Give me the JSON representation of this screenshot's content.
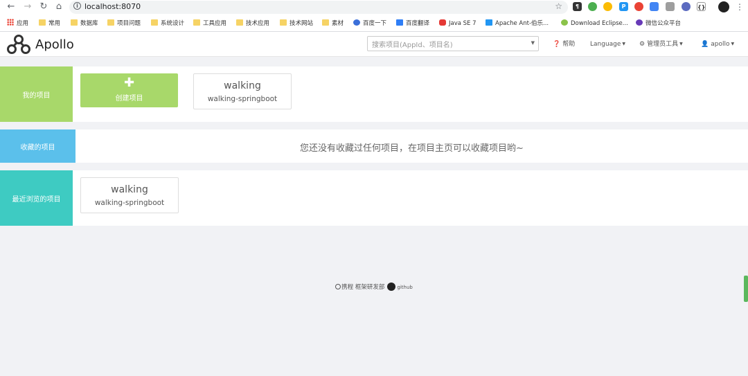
{
  "browser": {
    "url": "localhost:8070",
    "bookmarks": [
      "应用",
      "常用",
      "数据库",
      "项目问题",
      "系统设计",
      "工具应用",
      "技术应用",
      "技术网站",
      "素材",
      "百度一下",
      "百度翻译",
      "Java SE 7",
      "Apache Ant-伯乐...",
      "Download Eclipse...",
      "微信公众平台"
    ]
  },
  "header": {
    "logo_text": "Apollo",
    "search_placeholder": "搜索项目(AppId、项目名)",
    "help": "帮助",
    "language": "Language",
    "admin_tools": "管理员工具",
    "user": "apollo"
  },
  "my_projects": {
    "label": "我的项目",
    "create_label": "创建项目",
    "cards": [
      {
        "name": "walking",
        "id": "walking-springboot"
      }
    ]
  },
  "favorites": {
    "label": "收藏的项目",
    "empty_message": "您还没有收藏过任何项目，在项目主页可以收藏项目哟~"
  },
  "recent": {
    "label": "最近浏览的项目",
    "cards": [
      {
        "name": "walking",
        "id": "walking-springboot"
      }
    ]
  },
  "footer": {
    "company": "携程",
    "department": "框架研发部",
    "github": "github"
  },
  "colors": {
    "my_projects": "#a8d86a",
    "favorites": "#5bc0eb",
    "recent": "#3ecbc2"
  }
}
